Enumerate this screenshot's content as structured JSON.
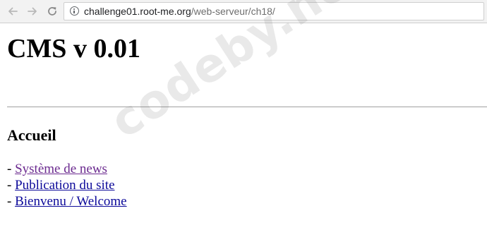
{
  "browser": {
    "url_host": "challenge01.root-me.org",
    "url_path": "/web-serveur/ch18/",
    "icons": [
      "back-arrow-icon",
      "forward-arrow-icon",
      "reload-icon",
      "info-icon"
    ]
  },
  "page": {
    "title": "CMS v 0.01",
    "section_heading": "Accueil",
    "link_prefix": "- ",
    "links": [
      {
        "label": "Système de news",
        "visited": true
      },
      {
        "label": "Publication du site",
        "visited": false
      },
      {
        "label": "Bienvenu / Welcome",
        "visited": false
      }
    ]
  },
  "watermark": {
    "text": "codeby.net"
  },
  "colors": {
    "visited_link": "#6b2a8f",
    "link": "#0d0a9a",
    "toolbar_bg": "#f2f2f2"
  }
}
